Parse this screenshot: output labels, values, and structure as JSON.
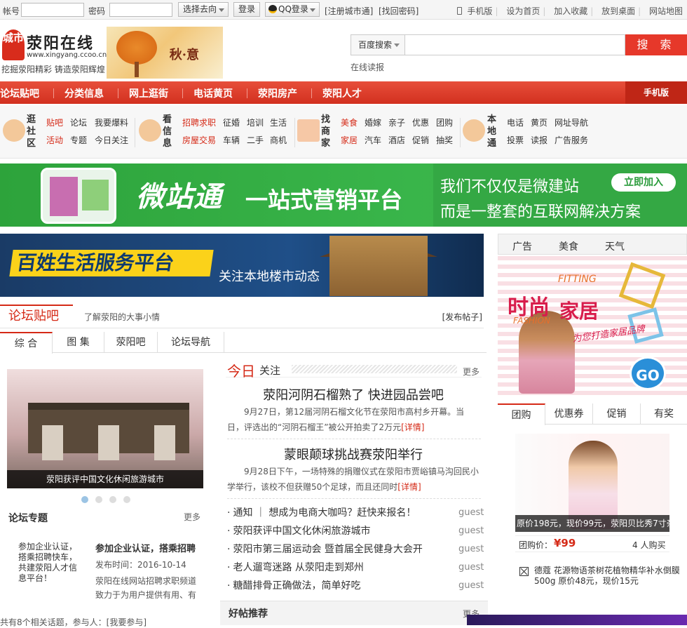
{
  "topbar": {
    "account_label": "帐号",
    "password_label": "密码",
    "direction_select": "选择去向",
    "login": "登录",
    "qq_login": "QQ登录",
    "register": "[注册城市通]",
    "forgot": "[找回密码]",
    "links": [
      "手机版",
      "设为首页",
      "加入收藏",
      "放到桌面",
      "网站地图"
    ]
  },
  "header": {
    "logo_badge": "城市",
    "logo_name": "荥阳在线",
    "logo_url": "www.xingyang.ccoo.cn",
    "slogan": "挖掘荥阳精彩 铸造荥阳辉煌",
    "autumn_text": "秋·意",
    "search_engine": "百度搜索",
    "search_button": "搜 索",
    "report_link": "在线读报"
  },
  "nav": {
    "items": [
      "论坛贴吧",
      "分类信息",
      "网上逛街",
      "电话黄页",
      "荥阳房产",
      "荥阳人才"
    ],
    "mobile": "手机版"
  },
  "subnav": {
    "groups": [
      {
        "title": "逛社区",
        "row1": [
          "贴吧",
          "论坛",
          "我要爆料"
        ],
        "row2": [
          "活动",
          "专题",
          "今日关注"
        ]
      },
      {
        "title": "看信息",
        "row1": [
          "招聘求职",
          "征婚",
          "培训",
          "生活"
        ],
        "row2": [
          "房屋交易",
          "车辆",
          "二手",
          "商机"
        ]
      },
      {
        "title": "找商家",
        "row1": [
          "美食",
          "婚嫁",
          "亲子",
          "优惠",
          "团购"
        ],
        "row2": [
          "家居",
          "汽车",
          "酒店",
          "促销",
          "抽奖"
        ]
      },
      {
        "title": "本地通",
        "row1": [
          "电话",
          "黄页",
          "网址导航"
        ],
        "row2": [
          "投票",
          "读报",
          "广告服务"
        ]
      }
    ]
  },
  "banner_wz": {
    "main": "微站通",
    "sub": "一站式营销平台",
    "right1": "我们不仅仅是微建站",
    "right2": "而是一整套的互联网解决方案",
    "join": "立即加入"
  },
  "banner_bx": {
    "main": "百姓生活服务平台",
    "sub": "关注本地楼市动态"
  },
  "forum": {
    "title": "论坛贴吧",
    "desc": "了解荥阳的大事小情",
    "post": "[发布帖子]",
    "tabs": [
      "综 合",
      "图 集",
      "荥阳吧",
      "论坛导航"
    ],
    "carousel_caption": "荥阳获评中国文化休闲旅游城市",
    "topic_title": "论坛专题",
    "topic_more": "更多",
    "topic_img_text": "参加企业认证，搭乘招聘快车，共建荥阳人才信息平台！",
    "topic_art_title": "参加企业认证，搭乘招聘",
    "topic_art_date": "发布时间：2016-10-14",
    "topic_art_body": "荥阳在线网站招聘求职频道致力于为用户提供有用、有",
    "bottom_text": "共有8个相关话题，参与人：[我要参与]"
  },
  "today": {
    "title_a": "今日",
    "title_b": "关注",
    "more": "更多",
    "articles": [
      {
        "title": "荥阳河阴石榴熟了 快进园品尝吧",
        "body": "9月27日，第12届河阴石榴文化节在荥阳市高村乡开幕。当日，评选出的“河阴石榴王”被公开拍卖了2万元",
        "detail": "[详情]"
      },
      {
        "title": "蒙眼颠球挑战赛荥阳举行",
        "body": "9月28日下午，一场特殊的捐赠仪式在荥阳市贾峪镇马沟回民小学举行，该校不但获赠50个足球，而且还同时",
        "detail": "[详情]"
      }
    ],
    "list": [
      {
        "text": "通知 ｜ 想成为电商大咖吗？赶快来报名！",
        "author": "guest"
      },
      {
        "text": "荥阳获评中国文化休闲旅游城市",
        "author": "guest"
      },
      {
        "text": "荥阳市第三届运动会 暨首届全民健身大会开",
        "author": "guest"
      },
      {
        "text": "老人遛弯迷路 从荥阳走到郑州",
        "author": "guest"
      },
      {
        "text": "糖醋排骨正确做法，简单好吃",
        "author": "guest"
      }
    ],
    "hot_title": "好帖推荐",
    "hot_more": "更多"
  },
  "right": {
    "tabs": [
      "广告",
      "美食",
      "天气"
    ],
    "ad_t1": "时尚",
    "ad_t2": "家居",
    "ad_fit": "FITTING",
    "ad_fashion": "FASHION",
    "ad_slogan": "为您打造家居品牌",
    "ad_go": "GO",
    "gb_tabs": [
      "团购",
      "优惠券",
      "促销",
      "有奖"
    ],
    "gb_caption": "原价198元，现价99元，荥阳贝比秀7寸杂",
    "gb_price_label": "团购价：",
    "gb_price": "¥99",
    "gb_buyers": "4 人购买",
    "gb_desc": "德蔻 花源物语茶树花植物精华补水倒膜500g 原价48元，现价15元"
  },
  "colors": {
    "accent": "#d52a17",
    "nav": "#e0402c",
    "wz_green": "#39b54a",
    "bx_blue": "#1f4f88"
  }
}
